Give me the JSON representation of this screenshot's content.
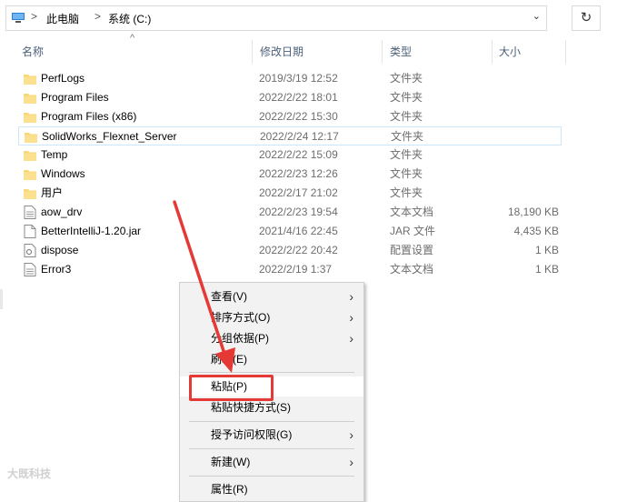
{
  "address": {
    "crumbs": [
      "此电脑",
      "系统 (C:)"
    ],
    "separator": ">",
    "dropdown_glyph": "⌄",
    "refresh_glyph": "↻"
  },
  "columns": {
    "name": "名称",
    "date": "修改日期",
    "type": "类型",
    "size": "大小"
  },
  "files": [
    {
      "name": "PerfLogs",
      "date": "2019/3/19 12:52",
      "type": "文件夹",
      "size": "",
      "icon": "folder-icon"
    },
    {
      "name": "Program Files",
      "date": "2022/2/22 18:01",
      "type": "文件夹",
      "size": "",
      "icon": "folder-icon"
    },
    {
      "name": "Program Files (x86)",
      "date": "2022/2/22 15:30",
      "type": "文件夹",
      "size": "",
      "icon": "folder-icon"
    },
    {
      "name": "SolidWorks_Flexnet_Server",
      "date": "2022/2/24 12:17",
      "type": "文件夹",
      "size": "",
      "icon": "folder-icon",
      "selected": true
    },
    {
      "name": "Temp",
      "date": "2022/2/22 15:09",
      "type": "文件夹",
      "size": "",
      "icon": "folder-icon"
    },
    {
      "name": "Windows",
      "date": "2022/2/23 12:26",
      "type": "文件夹",
      "size": "",
      "icon": "folder-icon"
    },
    {
      "name": "用户",
      "date": "2022/2/17 21:02",
      "type": "文件夹",
      "size": "",
      "icon": "folder-icon"
    },
    {
      "name": "aow_drv",
      "date": "2022/2/23 19:54",
      "type": "文本文档",
      "size": "18,190 KB",
      "icon": "text-file-icon"
    },
    {
      "name": "BetterIntelliJ-1.20.jar",
      "date": "2021/4/16 22:45",
      "type": "JAR 文件",
      "size": "4,435 KB",
      "icon": "jar-file-icon"
    },
    {
      "name": "dispose",
      "date": "2022/2/22 20:42",
      "type": "配置设置",
      "size": "1 KB",
      "icon": "config-file-icon"
    },
    {
      "name": "Error3",
      "date": "2022/2/19 1:37",
      "type": "文本文档",
      "size": "1 KB",
      "icon": "text-file-icon"
    }
  ],
  "context_menu": {
    "items": [
      {
        "label": "查看(V)",
        "submenu": true
      },
      {
        "label": "排序方式(O)",
        "submenu": true
      },
      {
        "label": "分组依据(P)",
        "submenu": true
      },
      {
        "label": "刷新(E)",
        "submenu": false
      },
      {
        "label": "粘贴(P)",
        "submenu": false,
        "highlighted": true
      },
      {
        "label": "粘贴快捷方式(S)",
        "submenu": false
      },
      {
        "label": "授予访问权限(G)",
        "submenu": true
      },
      {
        "label": "新建(W)",
        "submenu": true
      },
      {
        "label": "属性(R)",
        "submenu": false
      }
    ],
    "chevron": "›"
  },
  "watermark": "大既科技",
  "colors": {
    "folder": "#f8d775",
    "highlight_box": "#e53935",
    "arrow": "#e53935",
    "menu_bg": "#f2f2f2"
  }
}
